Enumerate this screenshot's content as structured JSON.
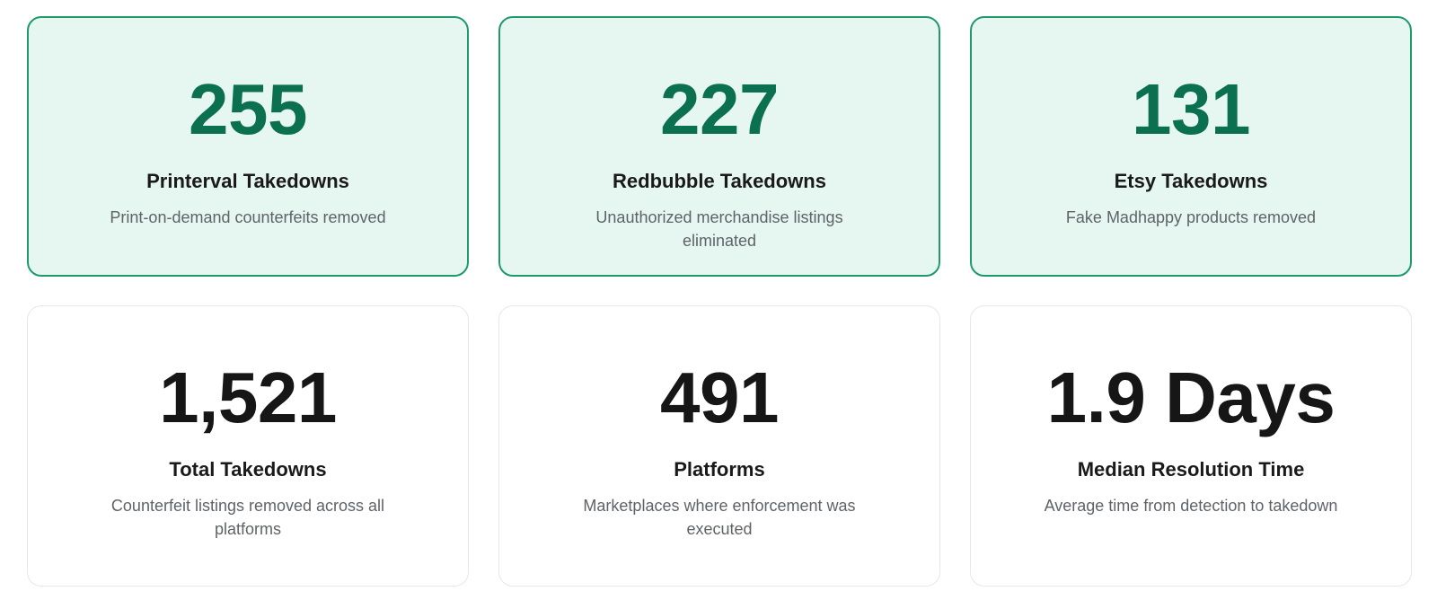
{
  "cards": [
    {
      "metric": "255",
      "label": "Printerval Takedowns",
      "desc": "Print-on-demand counterfeits removed"
    },
    {
      "metric": "227",
      "label": "Redbubble Takedowns",
      "desc": "Unauthorized merchandise listings eliminated"
    },
    {
      "metric": "131",
      "label": "Etsy Takedowns",
      "desc": "Fake Madhappy products removed"
    },
    {
      "metric": "1,521",
      "label": "Total Takedowns",
      "desc": "Counterfeit listings removed across all platforms"
    },
    {
      "metric": "491",
      "label": "Platforms",
      "desc": "Marketplaces where enforcement was executed"
    },
    {
      "metric": "1.9 Days",
      "label": "Median Resolution Time",
      "desc": "Average time from detection to takedown"
    }
  ],
  "colors": {
    "highlight_bg": "#e6f6f1",
    "highlight_border": "#1f9a6a",
    "highlight_number": "#0b7050",
    "plain_number": "#161616",
    "plain_border": "#e5e7eb"
  }
}
